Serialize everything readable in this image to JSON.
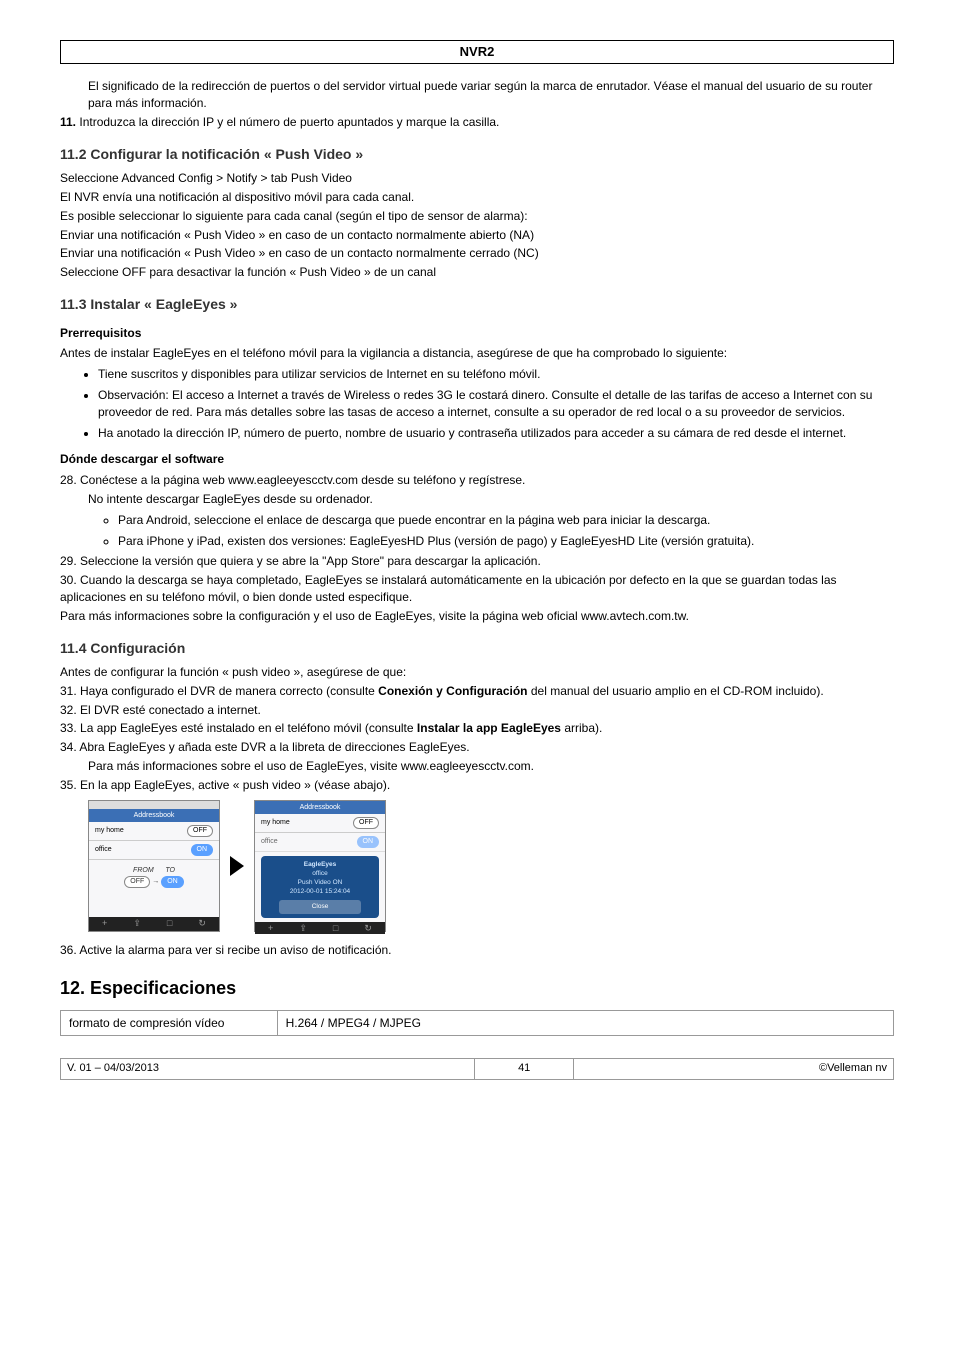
{
  "doc_title": "NVR2",
  "intro_p1": "El significado de la redirección de puertos o del servidor virtual puede variar según la marca de enrutador. Véase el manual del usuario de su router para más información.",
  "step11_num": "11.",
  "step11_text": "Introduzca la dirección IP y el número de puerto apuntados y marque la casilla.",
  "sec_11_2": "11.2   Configurar la notificación « Push Video »",
  "p_11_2_a": "Seleccione Advanced Config > Notify > tab Push Video",
  "p_11_2_b": "El NVR envía una notificación al dispositivo móvil para cada canal.",
  "p_11_2_c": "Es posible seleccionar lo siguiente para cada canal (según el tipo de sensor de alarma):",
  "p_11_2_d": "Enviar una notificación « Push Video » en caso de un contacto normalmente abierto (NA)",
  "p_11_2_e": "Enviar una notificación « Push Video » en caso de un contacto normalmente cerrado (NC)",
  "p_11_2_f": "Seleccione OFF para desactivar la función « Push Video » de un canal",
  "sec_11_3": "11.3   Instalar « EagleEyes »",
  "h_prereq": "Prerrequisitos",
  "prereq_intro": "Antes de instalar EagleEyes en el teléfono móvil para la vigilancia a distancia, asegúrese de que ha comprobado lo siguiente:",
  "prereq_b1": "Tiene suscritos y disponibles para utilizar servicios de Internet en su teléfono móvil.",
  "prereq_b2": "Observación: El acceso a Internet a través de Wireless o redes 3G le costará dinero. Consulte el detalle de las tarifas de acceso a Internet con su proveedor de red. Para más detalles sobre las tasas de acceso a internet, consulte a su operador de red local o a su proveedor de servicios.",
  "prereq_b3": "Ha anotado la dirección IP, número de puerto, nombre de usuario y contraseña utilizados para acceder a su cámara de red desde el internet.",
  "h_download": "Dónde descargar el software",
  "dl_28": "28. Conéctese a la página web www.eagleeyescctv.com desde su teléfono y regístrese.",
  "dl_28_sub": "No intente descargar EagleEyes desde su ordenador.",
  "dl_28_c1": "Para Android, seleccione el enlace de descarga que puede encontrar en la página web para iniciar la descarga.",
  "dl_28_c2": "Para iPhone y iPad, existen dos versiones: EagleEyesHD Plus (versión de pago) y EagleEyesHD Lite (versión gratuita).",
  "dl_29": "29. Seleccione la versión que quiera y se abre la \"App Store\" para descargar la aplicación.",
  "dl_30": "30. Cuando la descarga se haya completado, EagleEyes se instalará automáticamente en la ubicación por defecto en la que se guardan todas las aplicaciones en su teléfono móvil, o bien donde usted especifique.",
  "dl_more": "Para más informaciones sobre la configuración y el uso de EagleEyes, visite la página web oficial www.avtech.com.tw.",
  "sec_11_4": "11.4   Configuración",
  "cfg_intro": "Antes de configurar la función « push video », asegúrese de que:",
  "cfg_31a": "31. Haya configurado el DVR de manera correcto (consulte ",
  "cfg_31b": "Conexión y Configuración",
  "cfg_31c": " del manual del usuario amplio en el CD-ROM incluido).",
  "cfg_32": "32. El DVR esté conectado a internet.",
  "cfg_33a": "33. La app EagleEyes esté instalado en el teléfono móvil (consulte ",
  "cfg_33b": "Instalar la app EagleEyes",
  "cfg_33c": " arriba).",
  "cfg_34": "34. Abra EagleEyes y añada este DVR a la libreta de direcciones  EagleEyes.",
  "cfg_34_sub": "Para más informaciones sobre el uso de EagleEyes, visite www.eagleeyescctv.com.",
  "cfg_35": "35. En la app EagleEyes, active « push video » (véase abajo).",
  "cfg_36": "36. Active la alarma para ver si recibe un aviso de notificación.",
  "chap_12": "12.   Especificaciones",
  "spec_k1": "formato de compresión vídeo",
  "spec_v1": "H.264 / MPEG4 / MJPEG",
  "footer_left": "V. 01 – 04/03/2013",
  "footer_center": "41",
  "footer_right": "©Velleman nv",
  "phone": {
    "hdr": "Addressbook",
    "row1": "my home",
    "row2": "office",
    "off": "OFF",
    "on": "ON",
    "from": "FROM",
    "to": "TO",
    "popup_title": "EagleEyes",
    "popup_l1": "office",
    "popup_l2": "Push Video ON",
    "popup_l3": "2012-00-01 15:24:04",
    "popup_btn": "Close"
  }
}
